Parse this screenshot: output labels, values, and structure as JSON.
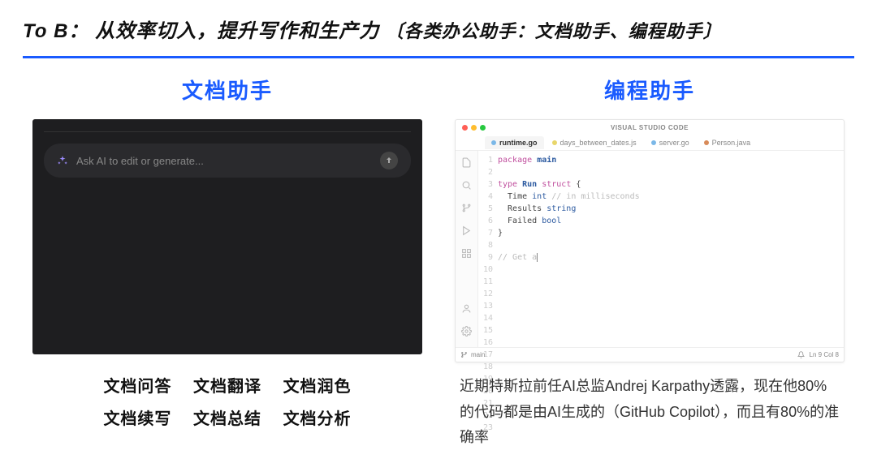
{
  "header": {
    "prefix": "To B：",
    "main": "从效率切入，提升写作和生产力",
    "sub": "〔各类办公助手：文档助手、编程助手〕"
  },
  "left": {
    "title": "文档助手",
    "ask_placeholder": "Ask AI to edit or generate...",
    "tags_row1": [
      "文档问答",
      "文档翻译",
      "文档润色"
    ],
    "tags_row2": [
      "文档续写",
      "文档总结",
      "文档分析"
    ]
  },
  "right": {
    "title": "编程助手",
    "vscode": {
      "app_title": "VISUAL STUDIO CODE",
      "tabs": [
        {
          "label": "runtime.go",
          "active": true,
          "kind": "go"
        },
        {
          "label": "days_between_dates.js",
          "active": false,
          "kind": "js"
        },
        {
          "label": "server.go",
          "active": false,
          "kind": "go"
        },
        {
          "label": "Person.java",
          "active": false,
          "kind": "java"
        }
      ],
      "code": [
        {
          "n": 1,
          "html": "<span class='kw'>package</span> <span class='ident'>main</span>"
        },
        {
          "n": 2,
          "html": ""
        },
        {
          "n": 3,
          "html": "<span class='kw'>type</span> <span class='ident'>Run</span> <span class='kw'>struct</span> {"
        },
        {
          "n": 4,
          "html": "&nbsp;&nbsp;Time <span class='type'>int</span> <span class='comment'>// in milliseconds</span>"
        },
        {
          "n": 5,
          "html": "&nbsp;&nbsp;Results <span class='type'>string</span>"
        },
        {
          "n": 6,
          "html": "&nbsp;&nbsp;Failed <span class='boolc'>bool</span>"
        },
        {
          "n": 7,
          "html": "}"
        },
        {
          "n": 8,
          "html": ""
        },
        {
          "n": 9,
          "html": "<span class='comment'>// Get a</span><span style='border-left:1px solid #888;'>&nbsp;</span>"
        },
        {
          "n": 10,
          "html": ""
        },
        {
          "n": 11,
          "html": ""
        },
        {
          "n": 12,
          "html": ""
        },
        {
          "n": 13,
          "html": ""
        },
        {
          "n": 14,
          "html": ""
        },
        {
          "n": 15,
          "html": ""
        },
        {
          "n": 16,
          "html": ""
        },
        {
          "n": 17,
          "html": ""
        },
        {
          "n": 18,
          "html": ""
        },
        {
          "n": 19,
          "html": ""
        },
        {
          "n": 20,
          "html": ""
        },
        {
          "n": 21,
          "html": ""
        },
        {
          "n": 22,
          "html": ""
        },
        {
          "n": 23,
          "html": ""
        }
      ],
      "status": {
        "branch": "main",
        "pos": "Ln 9 Col 8"
      }
    },
    "paragraph": "近期特斯拉前任AI总监Andrej Karpathy透露，现在他80%的代码都是由AI生成的（GitHub Copilot），而且有80%的准确率"
  }
}
